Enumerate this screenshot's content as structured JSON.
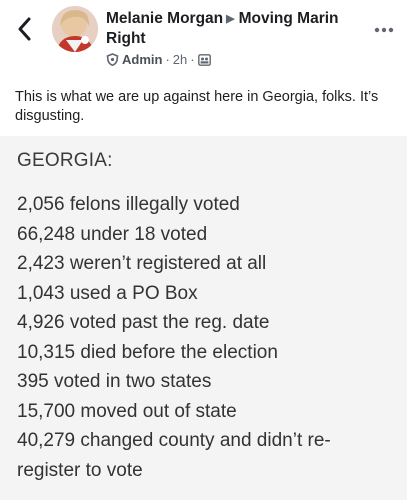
{
  "header": {
    "author_name": "Melanie Morgan",
    "group_name": "Moving Marin Right",
    "role": "Admin",
    "separator": "·",
    "timestamp": "2h",
    "separator2": "·"
  },
  "icons": {
    "back": "chevron-left-icon",
    "role": "admin-shield-icon",
    "audience": "group-audience-icon",
    "more": "more-horizontal-icon",
    "arrow": "triangle-right-icon"
  },
  "post": {
    "text": "This is what we are up against here in Georgia, folks. It’s disgusting."
  },
  "image": {
    "heading": "GEORGIA:",
    "lines": [
      "2,056 felons illegally voted",
      "66,248 under 18 voted",
      "2,423 weren’t registered at all",
      "1,043 used a PO Box",
      "4,926 voted past the reg. date",
      "10,315 died before the election",
      "395 voted in two states",
      "15,700 moved out of state",
      "40,279 changed county and didn’t re-",
      "register to vote"
    ]
  }
}
